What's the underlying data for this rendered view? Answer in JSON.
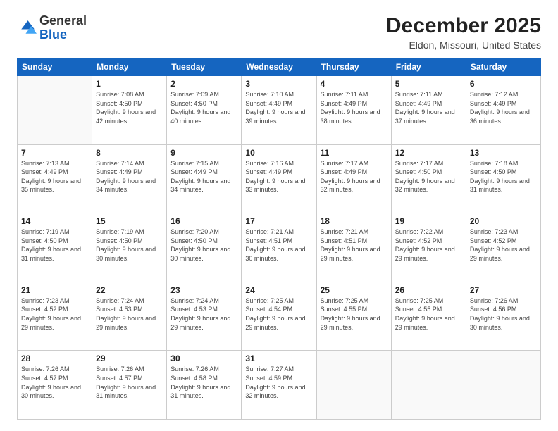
{
  "logo": {
    "general": "General",
    "blue": "Blue"
  },
  "header": {
    "month": "December 2025",
    "location": "Eldon, Missouri, United States"
  },
  "weekdays": [
    "Sunday",
    "Monday",
    "Tuesday",
    "Wednesday",
    "Thursday",
    "Friday",
    "Saturday"
  ],
  "weeks": [
    [
      {
        "day": null
      },
      {
        "day": 1,
        "sunrise": "7:08 AM",
        "sunset": "4:50 PM",
        "daylight": "9 hours and 42 minutes."
      },
      {
        "day": 2,
        "sunrise": "7:09 AM",
        "sunset": "4:50 PM",
        "daylight": "9 hours and 40 minutes."
      },
      {
        "day": 3,
        "sunrise": "7:10 AM",
        "sunset": "4:49 PM",
        "daylight": "9 hours and 39 minutes."
      },
      {
        "day": 4,
        "sunrise": "7:11 AM",
        "sunset": "4:49 PM",
        "daylight": "9 hours and 38 minutes."
      },
      {
        "day": 5,
        "sunrise": "7:11 AM",
        "sunset": "4:49 PM",
        "daylight": "9 hours and 37 minutes."
      },
      {
        "day": 6,
        "sunrise": "7:12 AM",
        "sunset": "4:49 PM",
        "daylight": "9 hours and 36 minutes."
      }
    ],
    [
      {
        "day": 7,
        "sunrise": "7:13 AM",
        "sunset": "4:49 PM",
        "daylight": "9 hours and 35 minutes."
      },
      {
        "day": 8,
        "sunrise": "7:14 AM",
        "sunset": "4:49 PM",
        "daylight": "9 hours and 34 minutes."
      },
      {
        "day": 9,
        "sunrise": "7:15 AM",
        "sunset": "4:49 PM",
        "daylight": "9 hours and 34 minutes."
      },
      {
        "day": 10,
        "sunrise": "7:16 AM",
        "sunset": "4:49 PM",
        "daylight": "9 hours and 33 minutes."
      },
      {
        "day": 11,
        "sunrise": "7:17 AM",
        "sunset": "4:49 PM",
        "daylight": "9 hours and 32 minutes."
      },
      {
        "day": 12,
        "sunrise": "7:17 AM",
        "sunset": "4:50 PM",
        "daylight": "9 hours and 32 minutes."
      },
      {
        "day": 13,
        "sunrise": "7:18 AM",
        "sunset": "4:50 PM",
        "daylight": "9 hours and 31 minutes."
      }
    ],
    [
      {
        "day": 14,
        "sunrise": "7:19 AM",
        "sunset": "4:50 PM",
        "daylight": "9 hours and 31 minutes."
      },
      {
        "day": 15,
        "sunrise": "7:19 AM",
        "sunset": "4:50 PM",
        "daylight": "9 hours and 30 minutes."
      },
      {
        "day": 16,
        "sunrise": "7:20 AM",
        "sunset": "4:50 PM",
        "daylight": "9 hours and 30 minutes."
      },
      {
        "day": 17,
        "sunrise": "7:21 AM",
        "sunset": "4:51 PM",
        "daylight": "9 hours and 30 minutes."
      },
      {
        "day": 18,
        "sunrise": "7:21 AM",
        "sunset": "4:51 PM",
        "daylight": "9 hours and 29 minutes."
      },
      {
        "day": 19,
        "sunrise": "7:22 AM",
        "sunset": "4:52 PM",
        "daylight": "9 hours and 29 minutes."
      },
      {
        "day": 20,
        "sunrise": "7:23 AM",
        "sunset": "4:52 PM",
        "daylight": "9 hours and 29 minutes."
      }
    ],
    [
      {
        "day": 21,
        "sunrise": "7:23 AM",
        "sunset": "4:52 PM",
        "daylight": "9 hours and 29 minutes."
      },
      {
        "day": 22,
        "sunrise": "7:24 AM",
        "sunset": "4:53 PM",
        "daylight": "9 hours and 29 minutes."
      },
      {
        "day": 23,
        "sunrise": "7:24 AM",
        "sunset": "4:53 PM",
        "daylight": "9 hours and 29 minutes."
      },
      {
        "day": 24,
        "sunrise": "7:25 AM",
        "sunset": "4:54 PM",
        "daylight": "9 hours and 29 minutes."
      },
      {
        "day": 25,
        "sunrise": "7:25 AM",
        "sunset": "4:55 PM",
        "daylight": "9 hours and 29 minutes."
      },
      {
        "day": 26,
        "sunrise": "7:25 AM",
        "sunset": "4:55 PM",
        "daylight": "9 hours and 29 minutes."
      },
      {
        "day": 27,
        "sunrise": "7:26 AM",
        "sunset": "4:56 PM",
        "daylight": "9 hours and 30 minutes."
      }
    ],
    [
      {
        "day": 28,
        "sunrise": "7:26 AM",
        "sunset": "4:57 PM",
        "daylight": "9 hours and 30 minutes."
      },
      {
        "day": 29,
        "sunrise": "7:26 AM",
        "sunset": "4:57 PM",
        "daylight": "9 hours and 31 minutes."
      },
      {
        "day": 30,
        "sunrise": "7:26 AM",
        "sunset": "4:58 PM",
        "daylight": "9 hours and 31 minutes."
      },
      {
        "day": 31,
        "sunrise": "7:27 AM",
        "sunset": "4:59 PM",
        "daylight": "9 hours and 32 minutes."
      },
      {
        "day": null
      },
      {
        "day": null
      },
      {
        "day": null
      }
    ]
  ],
  "labels": {
    "sunrise": "Sunrise:",
    "sunset": "Sunset:",
    "daylight": "Daylight:"
  }
}
